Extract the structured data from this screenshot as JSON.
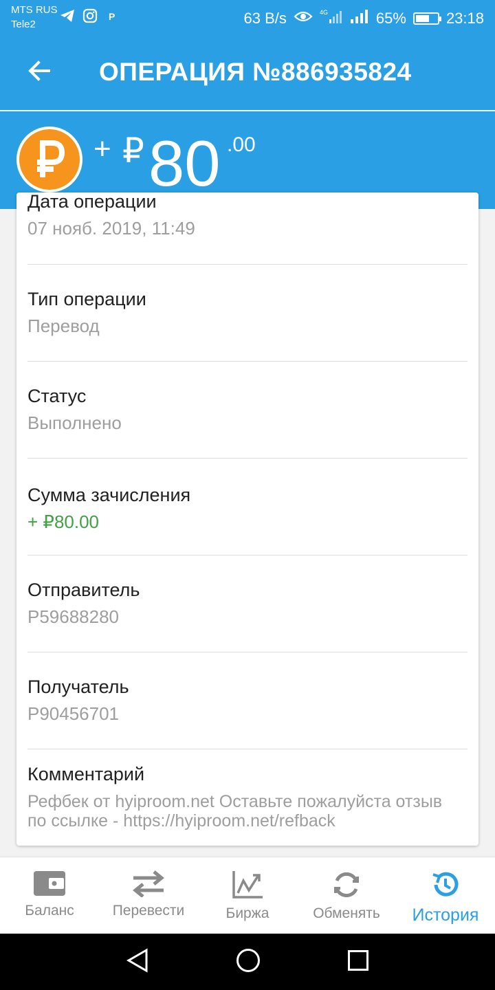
{
  "status_bar": {
    "carrier_1": "MTS RUS",
    "carrier_2": "Tele2",
    "net_speed": "63 B/s",
    "network_type": "4G",
    "battery_percent": "65%",
    "battery_level": 0.65,
    "time": "23:18",
    "icons": [
      "telegram-icon",
      "instagram-icon",
      "payeer-icon",
      "eye-icon",
      "signal-icon",
      "battery-icon"
    ]
  },
  "header": {
    "title": "ОПЕРАЦИЯ №886935824",
    "back_icon": "arrow-left-icon"
  },
  "amount": {
    "sign": "+",
    "currency": "₽",
    "integer": "80",
    "decimals": ".00",
    "coin_icon": "ruble-coin-icon"
  },
  "details": [
    {
      "label": "Дата операции",
      "value": "07 нояб. 2019, 11:49"
    },
    {
      "label": "Тип операции",
      "value": "Перевод"
    },
    {
      "label": "Статус",
      "value": "Выполнено"
    },
    {
      "label": "Сумма зачисления",
      "value": "+ ₽80.00"
    },
    {
      "label": "Отправитель",
      "value": "P59688280"
    },
    {
      "label": "Получатель",
      "value": "P90456701"
    },
    {
      "label": "Комментарий",
      "value": "Рефбек от hyiproom.net  Оставьте пожалуйста отзыв по ссылке - https://hyiproom.net/refback"
    }
  ],
  "bottom_nav": [
    {
      "label": "Баланс",
      "icon": "wallet-icon",
      "active": false
    },
    {
      "label": "Перевести",
      "icon": "transfer-icon",
      "active": false
    },
    {
      "label": "Биржа",
      "icon": "chart-icon",
      "active": false
    },
    {
      "label": "Обменять",
      "icon": "exchange-icon",
      "active": false
    },
    {
      "label": "История",
      "icon": "history-icon",
      "active": true
    }
  ],
  "colors": {
    "primary": "#2b9fe3",
    "coin": "#f7941d",
    "positive": "#43a047",
    "muted": "#9e9e9e"
  }
}
